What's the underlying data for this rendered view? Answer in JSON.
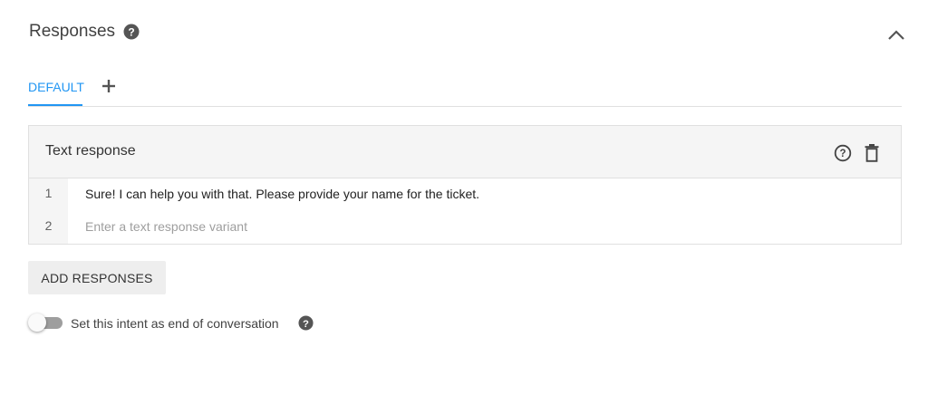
{
  "section": {
    "title": "Responses",
    "help_icon": "help-circle-icon",
    "collapse_icon": "chevron-up-icon"
  },
  "tabs": {
    "items": [
      {
        "label": "DEFAULT",
        "active": true
      }
    ],
    "add_icon": "plus-icon"
  },
  "card": {
    "title": "Text response",
    "help_icon": "help-outline-icon",
    "delete_icon": "trash-icon",
    "rows": [
      {
        "number": "1",
        "text": "Sure! I can help you with that. Please provide your name for the ticket."
      },
      {
        "number": "2",
        "text": "",
        "placeholder": "Enter a text response variant"
      }
    ]
  },
  "add_responses_button": "ADD RESPONSES",
  "end_conversation": {
    "label": "Set this intent as end of conversation",
    "enabled": false,
    "help_icon": "help-circle-icon"
  },
  "colors": {
    "accent": "#2196f3",
    "card_header_bg": "#f5f5f5",
    "button_bg": "#eeeeee"
  }
}
